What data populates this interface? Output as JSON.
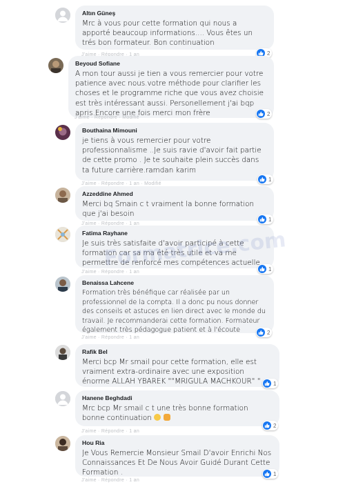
{
  "comments": [
    {
      "name": "Altın Güneş",
      "text": "Mrc à vous pour cette formation qui nous a apporté beaucoup informations.... Vous êtes un trés bon formateur. Bon continuation",
      "reactions": "2",
      "meta": "J'aime · Répondre · 1 an"
    },
    {
      "name": "Beyoud Sofiane",
      "text": "A mon tour aussi je tien a vous remercier pour votre patience avec nous.votre méthode pour clarifier les choses et le programme riche que vous avez choisie est très intéressant aussi. Personellement j'ai bqp apris.Encore une fois merci mon frère",
      "reactions": "2",
      "meta": "J'aime · Répondre · Modifié"
    },
    {
      "name": "Bouthaina Mimouni",
      "text": "je tiens à vous remercier pour votre professionnalisme ..Je suis ravie d'avoir fait partie de cette promo . Je te souhaite plein succès dans ta future carrière.ramdan karim",
      "reactions": "1",
      "meta": "J'aime · Répondre · 1 an · Modifié"
    },
    {
      "name": "Azzeddine Ahmed",
      "text": "Merci bq Smain c t vraiment la bonne formation que j'ai besoin",
      "reactions": "1",
      "meta": "J'aime · Répondre · 1 an"
    },
    {
      "name": "Fatima Rayhane",
      "text": "Je suis très satisfaite d'avoir participé à cette formation car sa ma été très utile et va me permettre de renforcé mes compétences actuelle",
      "reactions": "1",
      "meta": "J'aime · Répondre · 1 an"
    },
    {
      "name": "Benaissa Lahcene",
      "text": "Formation très bénéfique car réalisée par un professionnel de la compta. Il a donc pu nous donner des conseils et astuces en lien direct avec le monde du travail. Je recommanderai cette formation. Formateur également très pédagogue patient et à l'écoute",
      "reactions": "2",
      "meta": "J'aime · Répondre · 1 an"
    },
    {
      "name": "Rafik Bel",
      "text": "Merci bcp Mr smail pour cette formation, elle est vraiment extra-ordinaire avec une exposition énorme ALLAH YBAREK \"\"MRIGULA MACHKOUR\" \"",
      "reactions": "1",
      "meta": "J'aime · Répondre · 1 an"
    },
    {
      "name": "Hanene Beghdadi",
      "text": "Mrc bcp Mr smail c t une très bonne formation bonne continuation",
      "reactions": "2",
      "meta": "J'aime · Répondre · 1 an"
    },
    {
      "name": "Hou Ria",
      "text": "Je Vous Remercie Monsieur Smail D'avoir Enrichi Nos Connaissances Et De Nous Avoir Guidé Durant Cette Formation .",
      "reactions": "1",
      "meta": "J'aime · Répondre · 1 an"
    }
  ],
  "watermark": "Formatrice.com",
  "colors": {
    "like_blue": "#1877f2",
    "bubble_bg": "#f0f2f5"
  }
}
